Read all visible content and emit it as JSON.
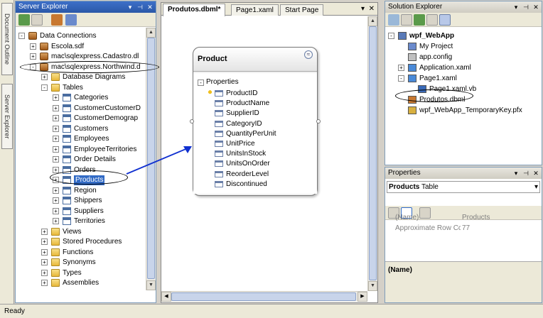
{
  "left_tabs": [
    "Document Outline",
    "Server Explorer"
  ],
  "server_explorer": {
    "title": "Server Explorer",
    "title_buttons": [
      "▾",
      "⊣",
      "✕"
    ],
    "tree": [
      {
        "label": "Data Connections",
        "level": 0,
        "expander": "-",
        "icon": "database-connections-icon"
      },
      {
        "label": "Escola.sdf",
        "level": 1,
        "expander": "+",
        "icon": "db-icon"
      },
      {
        "label": "mac\\sqlexpress.Cadastro.dl",
        "level": 1,
        "expander": "+",
        "icon": "db-icon"
      },
      {
        "label": "mac\\sqlexpress.Northwind.d",
        "level": 1,
        "expander": "-",
        "icon": "db-icon"
      },
      {
        "label": "Database Diagrams",
        "level": 2,
        "expander": "+",
        "icon": "folder-icon"
      },
      {
        "label": "Tables",
        "level": 2,
        "expander": "-",
        "icon": "folder-icon"
      },
      {
        "label": "Categories",
        "level": 3,
        "expander": "+",
        "icon": "table-icon"
      },
      {
        "label": "CustomerCustomerD",
        "level": 3,
        "expander": "+",
        "icon": "table-icon"
      },
      {
        "label": "CustomerDemograp",
        "level": 3,
        "expander": "+",
        "icon": "table-icon"
      },
      {
        "label": "Customers",
        "level": 3,
        "expander": "+",
        "icon": "table-icon"
      },
      {
        "label": "Employees",
        "level": 3,
        "expander": "+",
        "icon": "table-icon"
      },
      {
        "label": "EmployeeTerritories",
        "level": 3,
        "expander": "+",
        "icon": "table-icon"
      },
      {
        "label": "Order Details",
        "level": 3,
        "expander": "+",
        "icon": "table-icon"
      },
      {
        "label": "Orders",
        "level": 3,
        "expander": "+",
        "icon": "table-icon"
      },
      {
        "label": "Products",
        "level": 3,
        "expander": "+",
        "icon": "table-icon",
        "selected": true
      },
      {
        "label": "Region",
        "level": 3,
        "expander": "+",
        "icon": "table-icon"
      },
      {
        "label": "Shippers",
        "level": 3,
        "expander": "+",
        "icon": "table-icon"
      },
      {
        "label": "Suppliers",
        "level": 3,
        "expander": "+",
        "icon": "table-icon"
      },
      {
        "label": "Territories",
        "level": 3,
        "expander": "+",
        "icon": "table-icon"
      },
      {
        "label": "Views",
        "level": 2,
        "expander": "+",
        "icon": "folder-icon"
      },
      {
        "label": "Stored Procedures",
        "level": 2,
        "expander": "+",
        "icon": "folder-icon"
      },
      {
        "label": "Functions",
        "level": 2,
        "expander": "+",
        "icon": "folder-icon"
      },
      {
        "label": "Synonyms",
        "level": 2,
        "expander": "+",
        "icon": "folder-icon"
      },
      {
        "label": "Types",
        "level": 2,
        "expander": "+",
        "icon": "folder-icon"
      },
      {
        "label": "Assemblies",
        "level": 2,
        "expander": "+",
        "icon": "folder-icon"
      }
    ]
  },
  "doc_tabs": [
    {
      "label": "Produtos.dbml*",
      "active": true
    },
    {
      "label": "Page1.xaml",
      "active": false
    },
    {
      "label": "Start Page",
      "active": false
    }
  ],
  "doc_controls": [
    "▾",
    "✕"
  ],
  "entity": {
    "name": "Product",
    "collapse_glyph": "≈",
    "section": "Properties",
    "properties": [
      "ProductID",
      "ProductName",
      "SupplierID",
      "CategoryID",
      "QuantityPerUnit",
      "UnitPrice",
      "UnitsInStock",
      "UnitsOnOrder",
      "ReorderLevel",
      "Discontinued"
    ]
  },
  "solution_explorer": {
    "title": "Solution Explorer",
    "title_buttons": [
      "▾",
      "⊣",
      "✕"
    ],
    "tree": [
      {
        "label": "wpf_WebApp",
        "level": 0,
        "expander": "-",
        "bold": true
      },
      {
        "label": "My Project",
        "level": 1,
        "expander": ""
      },
      {
        "label": "app.config",
        "level": 1,
        "expander": ""
      },
      {
        "label": "Application.xaml",
        "level": 1,
        "expander": "+"
      },
      {
        "label": "Page1.xaml",
        "level": 1,
        "expander": "-"
      },
      {
        "label": "Page1.xaml.vb",
        "level": 2,
        "expander": ""
      },
      {
        "label": "Produtos.dbml",
        "level": 1,
        "expander": ""
      },
      {
        "label": "wpf_WebApp_TemporaryKey.pfx",
        "level": 1,
        "expander": ""
      }
    ]
  },
  "properties": {
    "title": "Properties",
    "title_buttons": [
      "▾",
      "⊣",
      "✕"
    ],
    "object_name": "Products",
    "object_type": "Table",
    "grid": [
      {
        "name": "(Name)",
        "value": "Products"
      },
      {
        "name": "Approximate Row Cc",
        "value": "77"
      }
    ],
    "description_title": "(Name)"
  },
  "status": {
    "text": "Ready"
  },
  "colors": {
    "title_active": "#2b58a8",
    "selection": "#316ac5",
    "arrow": "#1030d0"
  }
}
